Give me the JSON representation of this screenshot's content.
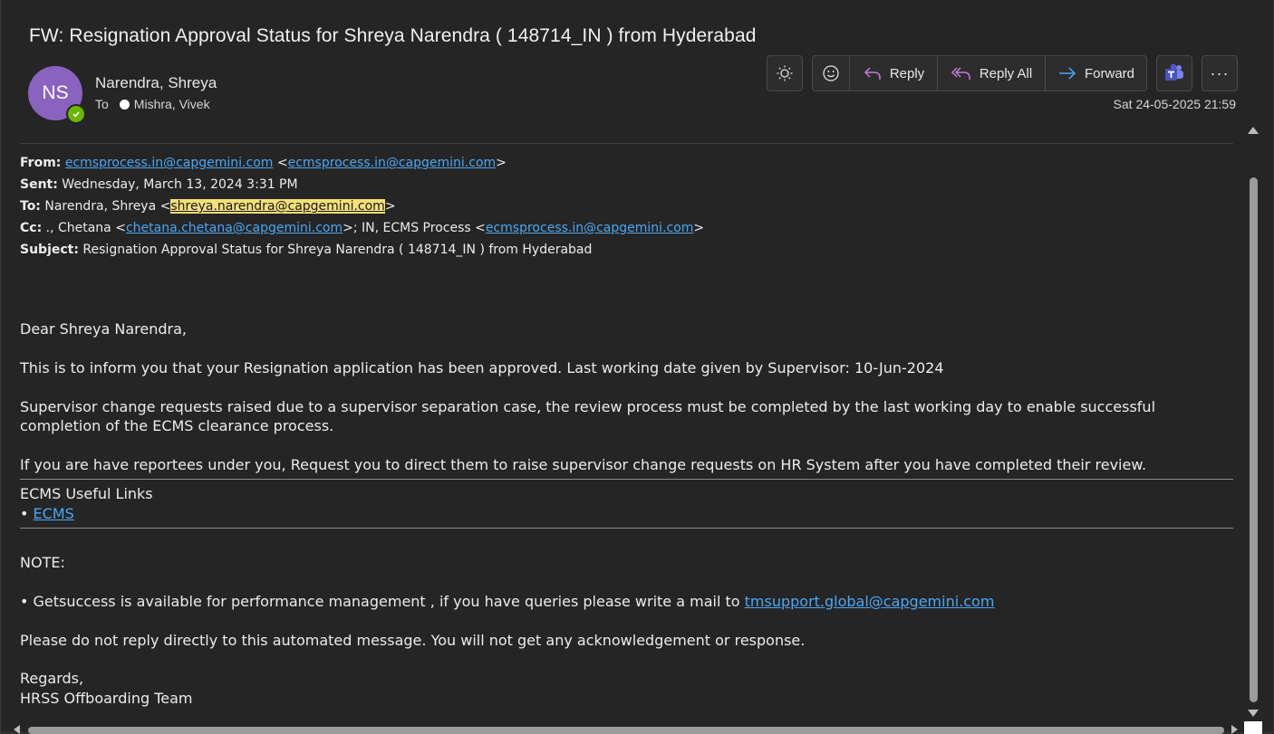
{
  "email": {
    "subject": "FW: Resignation Approval Status for Shreya Narendra ( 148714_IN ) from Hyderabad",
    "avatar_initials": "NS",
    "avatar_color": "#8a62c0",
    "presence_color": "#6bb700",
    "sender_name": "Narendra, Shreya",
    "to_label": "To",
    "to_name": "Mishra, Vivek",
    "date": "Sat 24-05-2025 21:59"
  },
  "toolbar": {
    "brightness_icon": "sun-icon",
    "emoji_icon": "smiley-icon",
    "reply_label": "Reply",
    "reply_all_label": "Reply All",
    "forward_label": "Forward",
    "teams_icon": "teams-icon",
    "more_label": "···"
  },
  "headers": {
    "from_label": "From:",
    "from_addr": "ecmsprocess.in@capgemini.com",
    "from_addr2": "ecmsprocess.in@capgemini.com",
    "sent_label": "Sent:",
    "sent_value": "Wednesday, March 13, 2024 3:31 PM",
    "to_label": "To:",
    "to_name": "Narendra, Shreya <",
    "to_addr": "shreya.narendra@capgemini.com",
    "cc_label": "Cc:",
    "cc_name1": "., Chetana <",
    "cc_addr1": "chetana.chetana@capgemini.com",
    "cc_mid": ">; IN, ECMS Process <",
    "cc_addr2": "ecmsprocess.in@capgemini.com",
    "subject_label": "Subject:",
    "subject_value": "Resignation Approval Status for Shreya Narendra ( 148714_IN ) from Hyderabad"
  },
  "body": {
    "greeting": "Dear Shreya Narendra,",
    "p1": "This is to inform you that your Resignation application has been approved. Last working date given by Supervisor: 10-Jun-2024",
    "p2": "Supervisor change requests raised due to a supervisor separation case, the review process must be completed by the last working day to enable successful completion of the ECMS clearance process.",
    "p3": "If you are have reportees under you, Request you to direct them to raise supervisor change requests on HR System after you have completed their review.",
    "links_title": "ECMS Useful Links",
    "bullet": "•",
    "link_ecms": "ECMS",
    "note": "NOTE:",
    "note_line": "• Getsuccess is available for performance management , if you have queries please write a mail to",
    "note_email": "tmsupport.global@capgemini.com",
    "do_not_reply": "Please do not reply directly to this automated message. You will not get any acknowledgement or response.",
    "regards": "Regards,",
    "team": "HRSS Offboarding Team"
  }
}
